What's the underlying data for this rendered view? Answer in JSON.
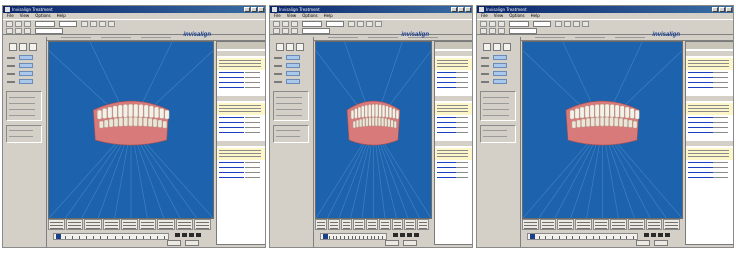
{
  "windows": [
    {
      "title": "Invisalign Treatment"
    },
    {
      "title": "Invisalign Treatment"
    },
    {
      "title": "Invisalign Treatment"
    }
  ],
  "menu": [
    "File",
    "View",
    "Options",
    "Help"
  ],
  "logo_text": "invisalign",
  "colors": {
    "viewport": "#1c62ac",
    "gum": "#d97a7a",
    "teeth": "#f4f1e8",
    "titlebar": "#0a246a"
  }
}
